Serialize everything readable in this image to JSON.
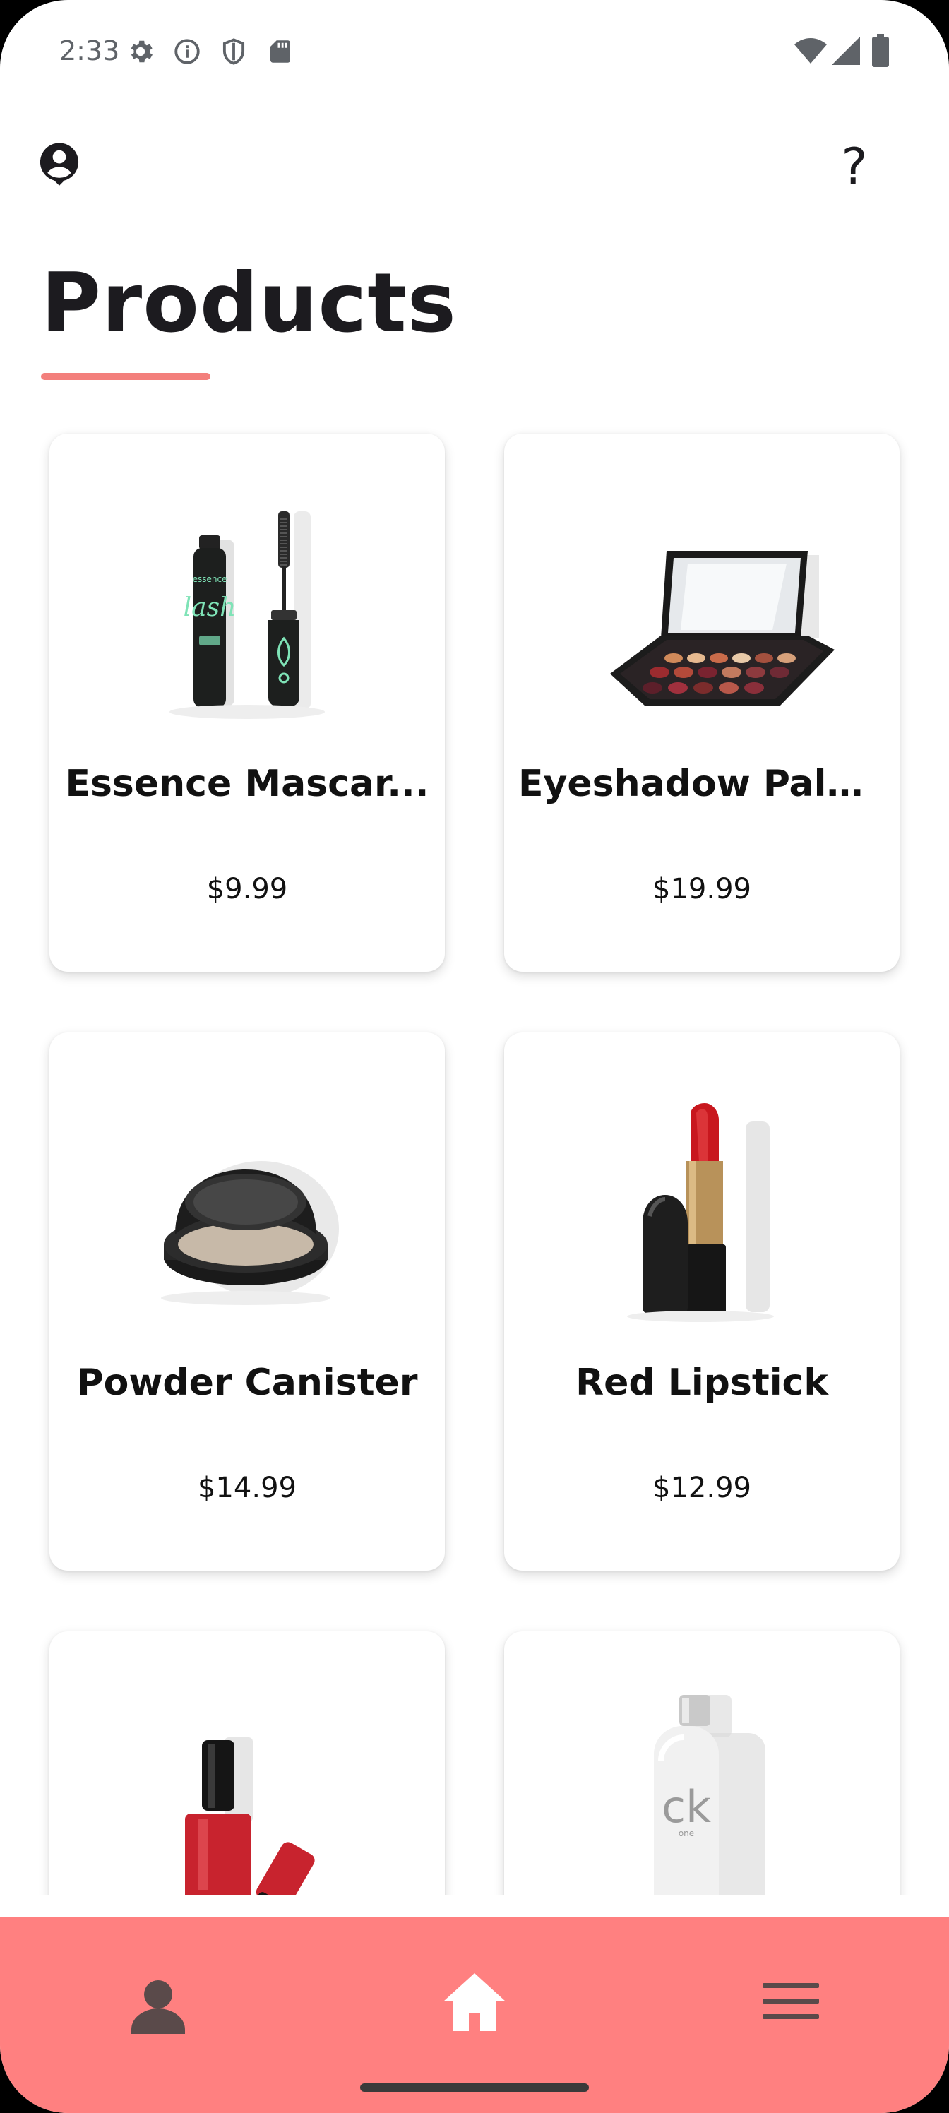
{
  "status_bar": {
    "time": "2:33",
    "left_icons": [
      "gear-icon",
      "info-icon",
      "shield-icon",
      "sd-card-icon"
    ],
    "right_icons": [
      "wifi-icon",
      "signal-icon",
      "battery-icon"
    ]
  },
  "top_bar": {
    "left_icon": "account-circle-icon",
    "right_icon": "help-icon",
    "help_glyph": "?"
  },
  "page": {
    "title": "Products",
    "accent_color": "#f37f7c"
  },
  "products": [
    {
      "name": "Essence Mascar...",
      "price": "$9.99",
      "image": "mascara"
    },
    {
      "name": "Eyeshadow Palet...",
      "price": "$19.99",
      "image": "eyeshadow-palette"
    },
    {
      "name": "Powder Canister",
      "price": "$14.99",
      "image": "powder-compact"
    },
    {
      "name": "Red Lipstick",
      "price": "$12.99",
      "image": "lipstick"
    },
    {
      "name": "",
      "price": "",
      "image": "nail-polish"
    },
    {
      "name": "",
      "price": "",
      "image": "perfume-bottle"
    }
  ],
  "product_image_text": {
    "mascara_brand": "essence",
    "mascara_label": "lash",
    "perfume_brand": "ck",
    "perfume_sub": "one"
  },
  "bottom_nav": {
    "background": "#ff8080",
    "items": [
      {
        "icon": "person-icon",
        "active": false
      },
      {
        "icon": "home-icon",
        "active": true
      },
      {
        "icon": "menu-icon",
        "active": false
      }
    ]
  }
}
